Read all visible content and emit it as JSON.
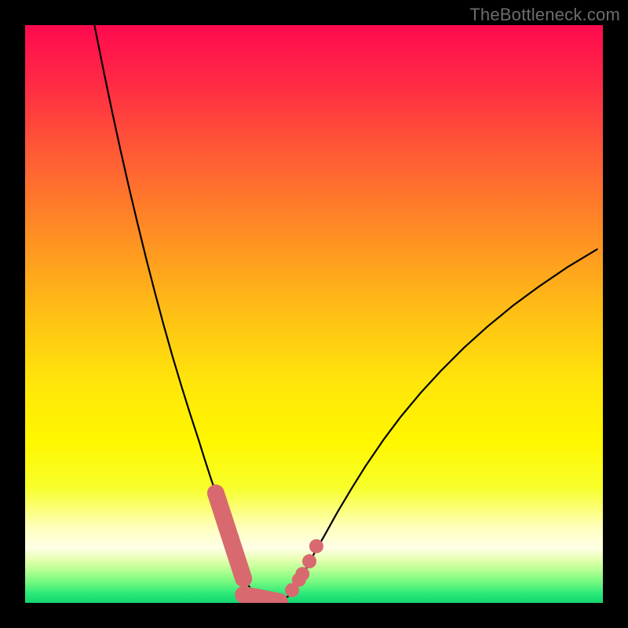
{
  "watermark": "TheBottleneck.com",
  "gradient": {
    "stops": [
      {
        "offset": 0.0,
        "color": "#ff0a4f"
      },
      {
        "offset": 0.1,
        "color": "#ff2a45"
      },
      {
        "offset": 0.22,
        "color": "#ff5a35"
      },
      {
        "offset": 0.35,
        "color": "#ff8a25"
      },
      {
        "offset": 0.5,
        "color": "#ffc015"
      },
      {
        "offset": 0.62,
        "color": "#ffe60a"
      },
      {
        "offset": 0.72,
        "color": "#fff700"
      },
      {
        "offset": 0.8,
        "color": "#f8ff2a"
      },
      {
        "offset": 0.87,
        "color": "#ffffbe"
      },
      {
        "offset": 0.905,
        "color": "#ffffe6"
      },
      {
        "offset": 0.925,
        "color": "#e6ffb0"
      },
      {
        "offset": 0.945,
        "color": "#b0ff90"
      },
      {
        "offset": 0.965,
        "color": "#70f880"
      },
      {
        "offset": 0.985,
        "color": "#28e878"
      },
      {
        "offset": 1.0,
        "color": "#15d66f"
      }
    ]
  },
  "curve": {
    "stroke": "#000000",
    "stroke_width": 2.2
  },
  "markers": {
    "fill": "#d86a6f",
    "stroke": "#d86a6f",
    "cap_stroke_width": 22,
    "dot_radius": 9
  },
  "chart_data": {
    "type": "line",
    "title": "",
    "xlabel": "",
    "ylabel": "",
    "xlim": [
      0,
      100
    ],
    "ylim": [
      0,
      100
    ],
    "x": [
      12.0,
      13.5,
      15.0,
      16.5,
      18.0,
      19.5,
      21.0,
      22.5,
      24.0,
      25.5,
      27.0,
      28.5,
      30.0,
      31.0,
      32.0,
      33.0,
      33.8,
      34.6,
      35.4,
      36.2,
      37.0,
      38.0,
      39.0,
      40.0,
      41.0,
      42.0,
      43.0,
      44.3,
      45.6,
      47.0,
      48.5,
      50.0,
      52.0,
      54.0,
      56.5,
      59.0,
      62.0,
      65.0,
      68.5,
      72.0,
      76.0,
      80.0,
      84.5,
      89.0,
      94.0,
      99.0
    ],
    "values": [
      100.0,
      92.5,
      85.3,
      78.4,
      71.8,
      65.5,
      59.4,
      53.6,
      48.0,
      42.7,
      37.7,
      32.9,
      28.3,
      25.1,
      22.0,
      19.0,
      16.2,
      13.5,
      10.9,
      8.4,
      6.0,
      4.0,
      2.5,
      1.3,
      0.5,
      0.1,
      0.0,
      0.3,
      1.2,
      3.0,
      5.6,
      8.5,
      12.0,
      15.6,
      19.8,
      23.8,
      28.2,
      32.2,
      36.4,
      40.2,
      44.2,
      47.8,
      51.5,
      54.8,
      58.2,
      61.2
    ],
    "marker_dots": [
      {
        "x": 46.2,
        "y": 2.2
      },
      {
        "x": 47.4,
        "y": 4.0
      },
      {
        "x": 48.0,
        "y": 5.0
      },
      {
        "x": 49.2,
        "y": 7.2
      },
      {
        "x": 50.4,
        "y": 9.8
      }
    ],
    "marker_caps": [
      {
        "x1": 33.0,
        "y1": 19.0,
        "x2": 37.8,
        "y2": 4.2
      },
      {
        "x1": 37.8,
        "y1": 1.4,
        "x2": 44.0,
        "y2": 0.2
      }
    ]
  }
}
